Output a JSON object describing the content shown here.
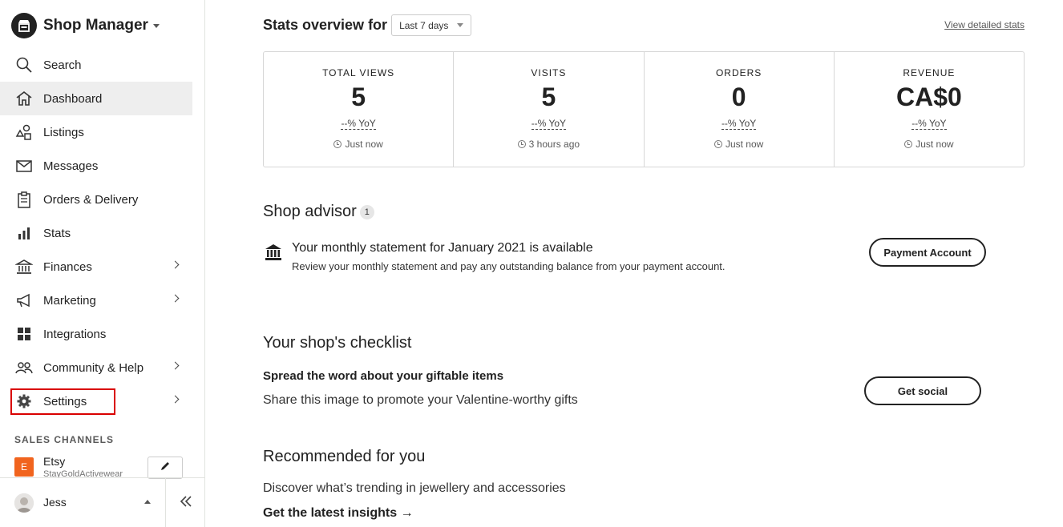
{
  "sidebar": {
    "brand": "Shop Manager",
    "nav": [
      {
        "label": "Search",
        "icon": "search-icon"
      },
      {
        "label": "Dashboard",
        "icon": "home-icon",
        "active": true
      },
      {
        "label": "Listings",
        "icon": "shapes-icon"
      },
      {
        "label": "Messages",
        "icon": "mail-icon"
      },
      {
        "label": "Orders & Delivery",
        "icon": "clipboard-icon"
      },
      {
        "label": "Stats",
        "icon": "bar-chart-icon"
      },
      {
        "label": "Finances",
        "icon": "bank-icon"
      },
      {
        "label": "Marketing",
        "icon": "megaphone-icon"
      },
      {
        "label": "Integrations",
        "icon": "grid-icon"
      },
      {
        "label": "Community & Help",
        "icon": "people-icon"
      },
      {
        "label": "Settings",
        "icon": "gear-icon"
      }
    ],
    "sales_channels_title": "SALES CHANNELS",
    "channel": {
      "badge": "E",
      "name": "Etsy",
      "shop": "StayGoldActivewear"
    },
    "user": {
      "name": "Jess"
    }
  },
  "stats": {
    "title": "Stats overview for",
    "range": "Last 7 days",
    "view_link": "View detailed stats",
    "items": [
      {
        "label": "TOTAL VIEWS",
        "value": "5",
        "yoy": "--% YoY",
        "time": "Just now"
      },
      {
        "label": "VISITS",
        "value": "5",
        "yoy": "--% YoY",
        "time": "3 hours ago"
      },
      {
        "label": "ORDERS",
        "value": "0",
        "yoy": "--% YoY",
        "time": "Just now"
      },
      {
        "label": "REVENUE",
        "value": "CA$0",
        "yoy": "--% YoY",
        "time": "Just now"
      }
    ]
  },
  "advisor": {
    "title": "Shop advisor",
    "count": "1",
    "item_title": "Your monthly statement for January 2021 is available",
    "item_desc": "Review your monthly statement and pay any outstanding balance from your payment account.",
    "button": "Payment Account"
  },
  "checklist": {
    "title": "Your shop's checklist",
    "item_title": "Spread the word about your giftable items",
    "item_desc": "Share this image to promote your Valentine-worthy gifts",
    "button": "Get social"
  },
  "recommended": {
    "title": "Recommended for you",
    "desc": "Discover what’s trending in jewellery and accessories",
    "link": "Get the latest insights →"
  }
}
